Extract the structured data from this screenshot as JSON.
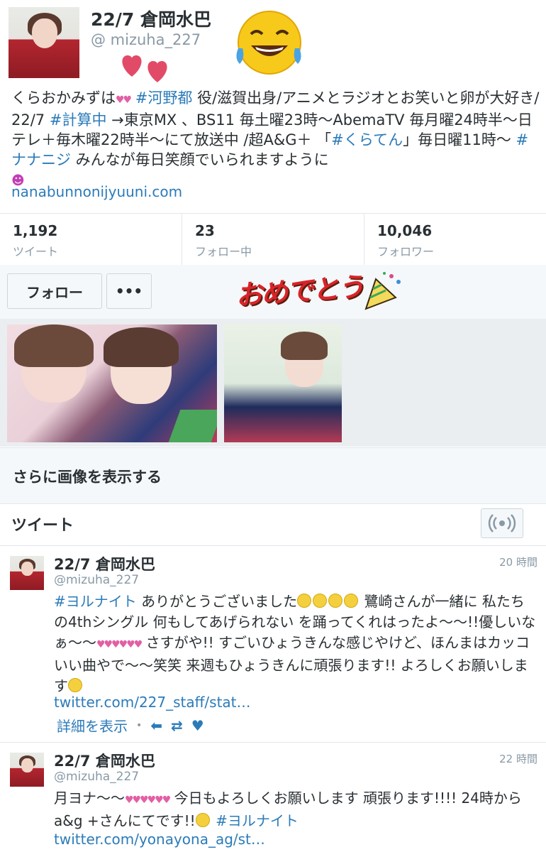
{
  "profile": {
    "name": "22/7 倉岡水巴",
    "handle": "@ mizuha_227",
    "bio": {
      "p1": "くらおかみずは",
      "t1": "#河野都",
      "p2": " 役/滋賀出身/アニメとラジオとお笑いと卵",
      "p3": "が大好き/ 22/7 ",
      "t2": "#計算中",
      "p4": " →東京MX 、BS11 毎土曜23時〜AbemaTV 毎月曜24時半〜日テレ＋毎木曜22時半〜にて放送中 /超A&G＋ 「",
      "t3": "#くらてん",
      "p5": "」毎日曜11時〜 ",
      "t4": "#ナナニジ",
      "p6": " みんなが毎日笑顔でいられますように"
    },
    "website": "nanabunnonijyuuni.com"
  },
  "stats": [
    {
      "value": "1,192",
      "label": "ツイート"
    },
    {
      "value": "23",
      "label": "フォロー中"
    },
    {
      "value": "10,046",
      "label": "フォロワー"
    }
  ],
  "actions": {
    "follow": "フォロー",
    "more": "•••"
  },
  "sticker": {
    "text": "おめでとう"
  },
  "gallery": {
    "more_images": "さらに画像を表示する"
  },
  "tweets_section": {
    "title": "ツイート"
  },
  "tweets": [
    {
      "name": "22/7 倉岡水巴",
      "handle": "@mizuha_227",
      "time": "20 時間",
      "tag": "#ヨルナイト",
      "text_a": " ありがとうございました",
      "text_b": " 鷺崎さんが一緒に 私たちの4thシングル 何もしてあげられない を踊ってくれはったよ〜〜!!優しいなぁ〜〜",
      "text_c": " さすがや!! すごいひょうきんな感じやけど、ほんまはカッコいい曲やで〜〜笑笑 来週もひょうきんに頑張ります!! よろしくお願いします",
      "link": "twitter.com/227_staff/stat…",
      "details": "詳細を表示"
    },
    {
      "name": "22/7 倉岡水巴",
      "handle": "@mizuha_227",
      "time": "22 時間",
      "text_a": "月ヨナ〜〜",
      "text_b": " 今日もよろしくお願いします",
      "text_c": " 頑張ります!!!! 24時から a&g +さんにてです!!",
      "tag": "#ヨルナイト",
      "link": "twitter.com/yonayona_ag/st…"
    }
  ],
  "colors": {
    "link": "#2b7bb9",
    "muted": "#8899a6",
    "text": "#292f33",
    "border": "#e1e8ed"
  }
}
